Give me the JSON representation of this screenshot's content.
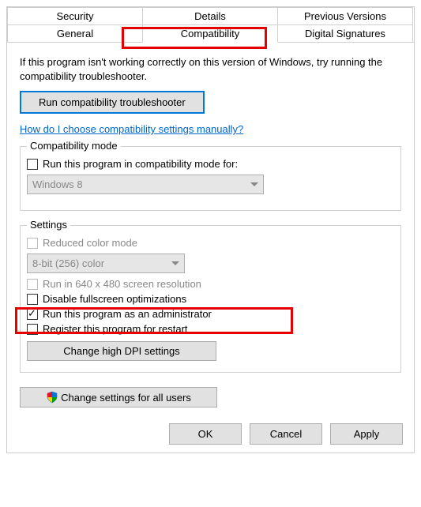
{
  "tabs_row1": [
    "Security",
    "Details",
    "Previous Versions"
  ],
  "tabs_row2": [
    "General",
    "Compatibility",
    "Digital Signatures"
  ],
  "intro": "If this program isn't working correctly on this version of Windows, try running the compatibility troubleshooter.",
  "btn_troubleshoot": "Run compatibility troubleshooter",
  "link_manual": "How do I choose compatibility settings manually?",
  "group_compat": {
    "title": "Compatibility mode",
    "cb_label": "Run this program in compatibility mode for:",
    "combo": "Windows 8"
  },
  "group_settings": {
    "title": "Settings",
    "cb_reduced": "Reduced color mode",
    "combo_color": "8-bit (256) color",
    "cb_640": "Run in 640 x 480 screen resolution",
    "cb_fullscreen": "Disable fullscreen optimizations",
    "cb_admin": "Run this program as an administrator",
    "cb_restart": "Register this program for restart",
    "btn_dpi": "Change high DPI settings"
  },
  "btn_allusers": "Change settings for all users",
  "footer": {
    "ok": "OK",
    "cancel": "Cancel",
    "apply": "Apply"
  }
}
